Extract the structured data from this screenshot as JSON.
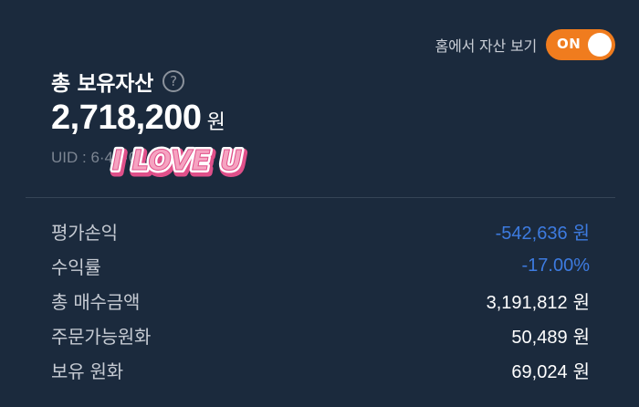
{
  "home_toggle": {
    "label": "홈에서 자산 보기",
    "state_text": "ON",
    "accent_color": "#f07c1e"
  },
  "summary": {
    "title": "총 보유자산",
    "help_icon": "?",
    "total_amount": "2,718,200",
    "currency_unit": "원",
    "uid_text": "UID : 6·4···0"
  },
  "sticker": {
    "text": "I LOVE U",
    "fill_color": "#f6a3c1",
    "outline_color": "#ffffff",
    "shadow_color": "#e0508a"
  },
  "metrics": [
    {
      "label": "평가손익",
      "value": "-542,636",
      "unit": "원",
      "status": "negative"
    },
    {
      "label": "수익률",
      "value": "-17.00%",
      "unit": "",
      "status": "negative"
    },
    {
      "label": "총 매수금액",
      "value": "3,191,812",
      "unit": "원",
      "status": "neutral"
    },
    {
      "label": "주문가능원화",
      "value": "50,489",
      "unit": "원",
      "status": "neutral"
    },
    {
      "label": "보유 원화",
      "value": "69,024",
      "unit": "원",
      "status": "neutral"
    }
  ],
  "colors": {
    "background": "#1b2a3d",
    "negative": "#3d7be0",
    "label": "#c6cbd3"
  }
}
